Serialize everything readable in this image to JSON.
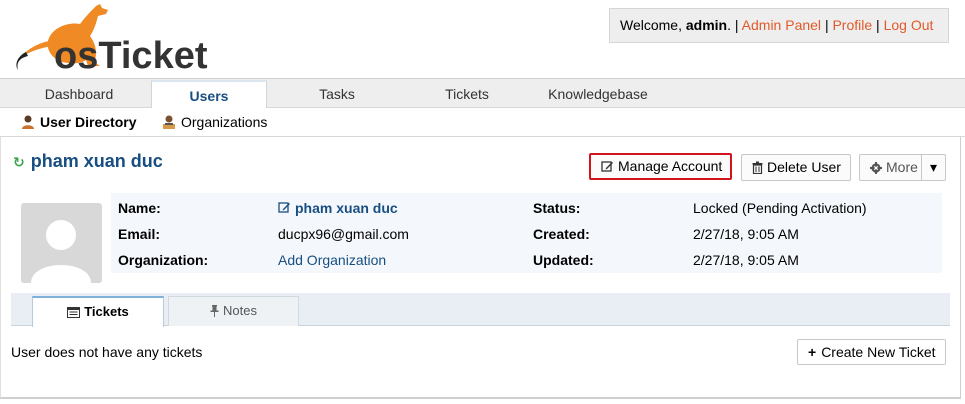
{
  "header": {
    "logo_text": "osTicket",
    "welcome_prefix": "Welcome, ",
    "username": "admin",
    "welcome_suffix": ". ",
    "separator": "|",
    "admin_panel": "Admin Panel",
    "profile": "Profile",
    "logout": "Log Out"
  },
  "nav": {
    "tabs": [
      {
        "label": "Dashboard",
        "active": false
      },
      {
        "label": "Users",
        "active": true
      },
      {
        "label": "Tasks",
        "active": false
      },
      {
        "label": "Tickets",
        "active": false
      },
      {
        "label": "Knowledgebase",
        "active": false
      }
    ],
    "subnav": [
      {
        "label": "User Directory",
        "active": true,
        "icon": "user-directory-icon"
      },
      {
        "label": "Organizations",
        "active": false,
        "icon": "organizations-icon"
      }
    ]
  },
  "user": {
    "title": "pham xuan duc",
    "name_label": "Name:",
    "name_value": "pham xuan duc",
    "email_label": "Email:",
    "email_value": "ducpx96@gmail.com",
    "org_label": "Organization:",
    "org_value": "Add Organization",
    "status_label": "Status:",
    "status_value": "Locked (Pending Activation)",
    "created_label": "Created:",
    "created_value": "2/27/18, 9:05 AM",
    "updated_label": "Updated:",
    "updated_value": "2/27/18, 9:05 AM"
  },
  "actions": {
    "manage_account": "Manage Account",
    "delete_user": "Delete User",
    "more": "More"
  },
  "tabs": {
    "tickets": "Tickets",
    "notes": "Notes"
  },
  "tickets_panel": {
    "empty_message": "User does not have any tickets",
    "create_button": "Create New Ticket"
  },
  "colors": {
    "brand_orange": "#f08a24",
    "title_blue": "#184e81",
    "link_orange": "#e05a2b",
    "highlight_red": "#d4141c",
    "refresh_green": "#3ea24e"
  }
}
